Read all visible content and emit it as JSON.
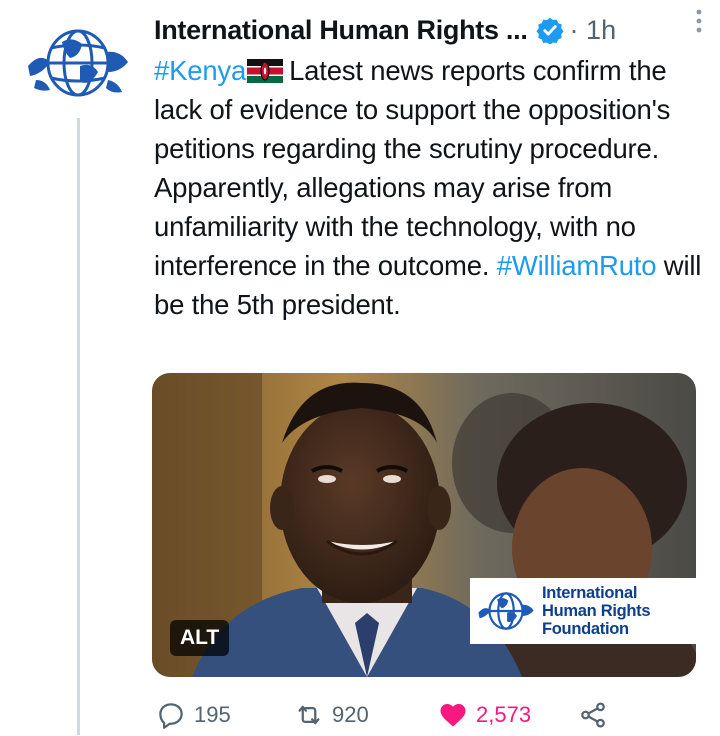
{
  "author": {
    "name": "International Human Rights ...",
    "verified": true,
    "separator": "·",
    "time": "1h",
    "avatar_icon": "globe-logo-icon"
  },
  "tweet": {
    "hashtag_1": "#Kenya",
    "text_1": "Latest news reports confirm the lack of evidence to support the opposition's petitions regarding the scrutiny procedure. Apparently, allegations may arise from unfamiliarity with the technology, with no interference in the outcome.",
    "hashtag_2": "#WilliamRuto",
    "text_2": "will be the 5th president."
  },
  "media": {
    "alt_label": "ALT",
    "watermark_line_1": "International",
    "watermark_line_2": "Human Rights",
    "watermark_line_3": "Foundation"
  },
  "actions": {
    "reply_count": "195",
    "retweet_count": "920",
    "like_count": "2,573",
    "liked": true
  },
  "colors": {
    "link": "#1d9bf0",
    "like": "#f91880",
    "muted": "#536471",
    "brand_blue": "#1f5bb5"
  }
}
